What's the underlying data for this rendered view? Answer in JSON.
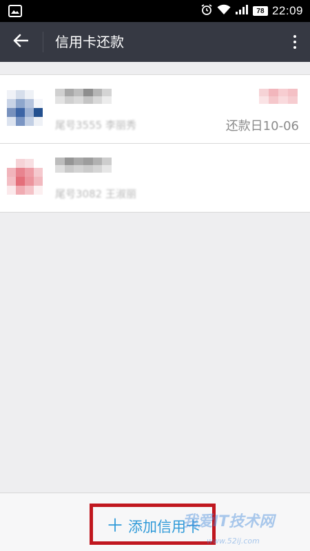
{
  "status_bar": {
    "time": "22:09",
    "battery": "78"
  },
  "header": {
    "title": "信用卡还款"
  },
  "cards": [
    {
      "sub_text": "尾号3555 李丽秀",
      "due_date": "还款日10-06",
      "accent": "#3c64a5"
    },
    {
      "sub_text": "尾号3082 王淑丽",
      "due_date": "",
      "accent": "#e46f7a"
    }
  ],
  "bottom": {
    "add_card_label": "添加信用卡"
  },
  "watermark": {
    "text": "我爱IT技术网",
    "url": "www.52ij.com"
  },
  "colors": {
    "header_bg": "#363943",
    "accent_blue": "#2f9ad8",
    "highlight_red": "#c0171f"
  }
}
